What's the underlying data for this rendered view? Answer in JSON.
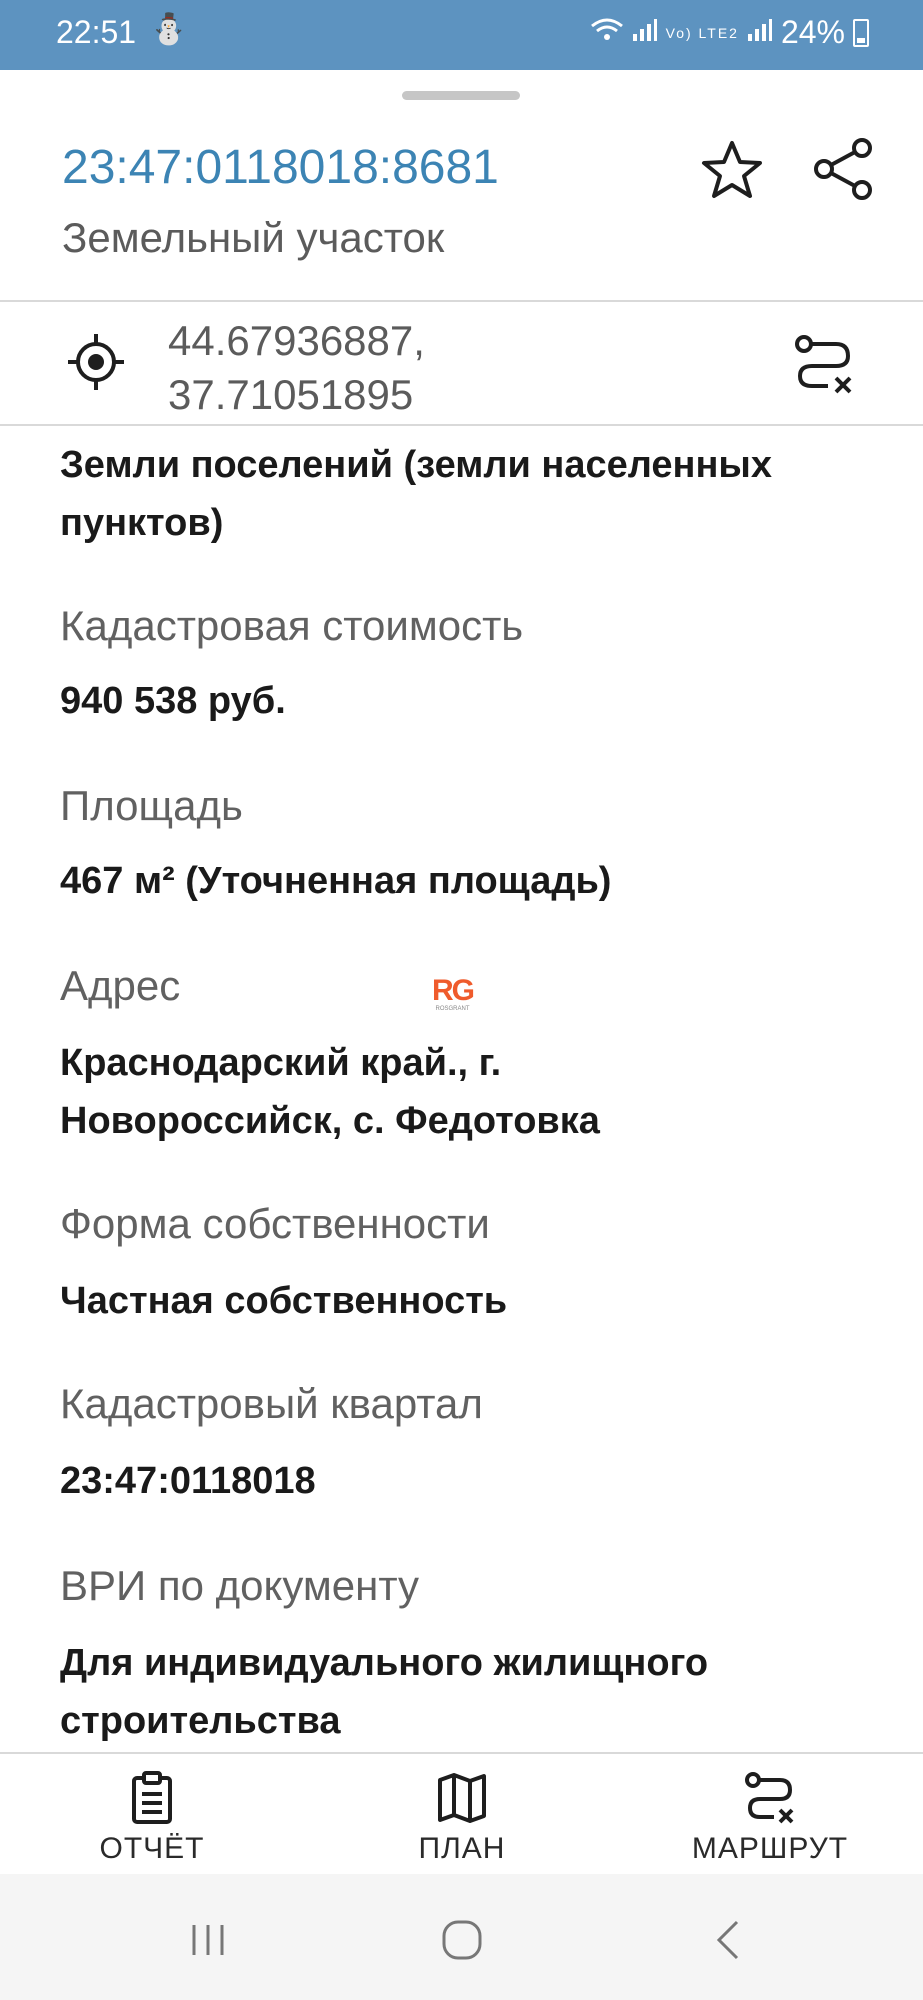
{
  "status_bar": {
    "time": "22:51",
    "extra_indicator": "⛄",
    "network": "Vo) LTE2",
    "battery": "24%"
  },
  "header": {
    "title": "23:47:0118018:8681",
    "subtitle": "Земельный участок"
  },
  "location": {
    "coords_line1": "44.67936887,",
    "coords_line2": "37.71051895"
  },
  "details": {
    "land_category": {
      "line1": "Земли поселений (земли населенных",
      "line2": "пунктов)"
    },
    "cadastral_cost": {
      "label": "Кадастровая стоимость",
      "value": "940 538 руб."
    },
    "area": {
      "label": "Площадь",
      "value": "467 м² (Уточненная площадь)"
    },
    "address": {
      "label": "Адрес",
      "line1": "Краснодарский край., г.",
      "line2": "Новороссийск, с. Федотовка"
    },
    "ownership": {
      "label": "Форма собственности",
      "value": "Частная собственность"
    },
    "cadastral_quarter": {
      "label": "Кадастровый квартал",
      "value": "23:47:0118018"
    },
    "vri": {
      "label": "ВРИ по документу",
      "line1": "Для индивидуального жилищного",
      "line2": "строительства"
    }
  },
  "watermark": {
    "logo_text": "RG",
    "logo_sub": "ROSGRANT"
  },
  "bottom_nav": {
    "items": [
      {
        "label": "ОТЧЁТ",
        "icon": "clipboard-icon"
      },
      {
        "label": "ПЛАН",
        "icon": "map-icon"
      },
      {
        "label": "МАРШРУТ",
        "icon": "route-icon"
      }
    ]
  },
  "colors": {
    "status_bar": "#5d93c0",
    "title_link": "#3c84b4",
    "logo": "#ef5b2c"
  }
}
